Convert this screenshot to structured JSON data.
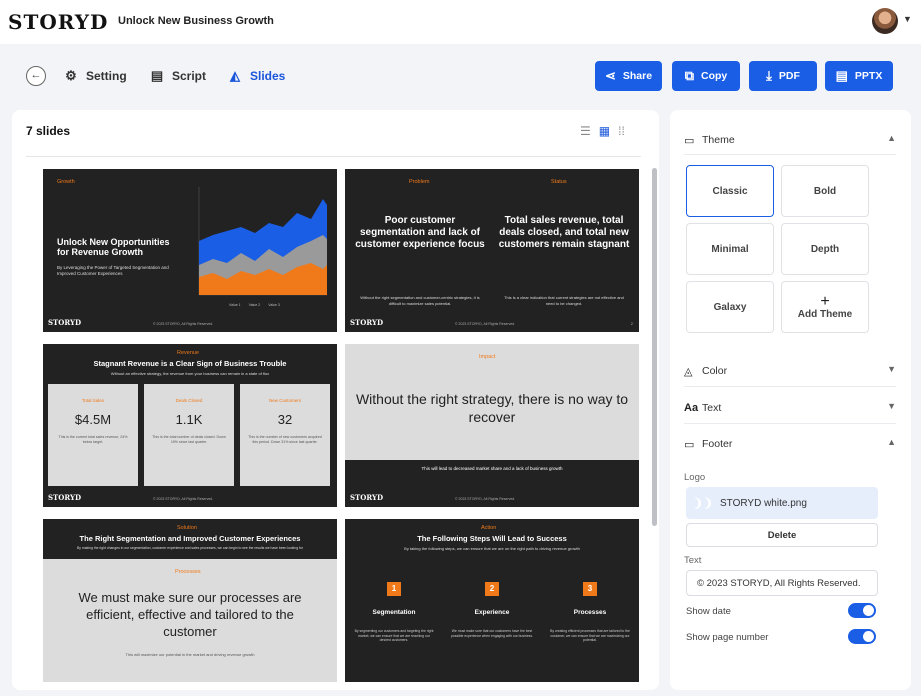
{
  "header": {
    "brand": "STORYD",
    "title": "Unlock New Business Growth"
  },
  "toolbar": {
    "setting_label": "Setting",
    "script_label": "Script",
    "slides_label": "Slides",
    "share_label": "Share",
    "copy_label": "Copy",
    "pdf_label": "PDF",
    "pptx_label": "PPTX"
  },
  "main": {
    "slide_count": "7 slides"
  },
  "slides": [
    {
      "label": "Growth",
      "title": "Unlock New Opportunities for Revenue Growth",
      "subtitle": "By Leveraging the Power of Targeted Segmentation and Improved Customer Experiences",
      "legend": [
        "Value 1",
        "Value 2",
        "Value 3"
      ]
    },
    {
      "left_label": "Problem",
      "left_title": "Poor customer segmentation and lack of customer experience focus",
      "left_text": "Without the right segmentation and customer-centric strategies, it is difficult to maximize sales potential.",
      "right_label": "Status",
      "right_title": "Total sales revenue, total deals closed, and total new customers remain stagnant",
      "right_text": "This is a clear indication that current strategies are not effective and need to be changed."
    },
    {
      "label": "Revenue",
      "title": "Stagnant Revenue is a Clear Sign of Business Trouble",
      "subtitle": "Without an effective strategy, the revenue from your business can remain in a state of flux",
      "cards": [
        {
          "label": "Total Sales",
          "value": "$4.5M",
          "text": "This is the current total sales revenue, 24% below target."
        },
        {
          "label": "Deals Closed",
          "value": "1.1K",
          "text": "This is the total number of deals closed. Down 19% since last quarter."
        },
        {
          "label": "New Customers",
          "value": "32",
          "text": "This is the number of new customers acquired this period. Down 31% since last quarter."
        }
      ]
    },
    {
      "label": "Impact",
      "title": "Without the right strategy, there is no way to recover",
      "footer_text": "This will lead to decreased market share and a lack of business growth"
    },
    {
      "label": "Solution",
      "title": "The Right Segmentation and Improved Customer Experiences",
      "subtitle": "By making the right changes in our segmentation, customer experience and sales processes, we can begin to see the results we have been looking for",
      "sub_label": "Processes",
      "body": "We must make sure our processes are efficient, effective and tailored to the customer",
      "footer_text": "This will maximize our potential in the market and driving revenue growth"
    },
    {
      "label": "Action",
      "title": "The Following Steps Will Lead to Success",
      "subtitle": "By taking the following steps, we can ensure that we are on the right path to driving revenue growth",
      "steps": [
        {
          "num": "1",
          "name": "Segmentation",
          "text": "By segmenting our customers and targeting the right market, we can ensure that we are reaching our desired customers."
        },
        {
          "num": "2",
          "name": "Experience",
          "text": "We must make sure that our customers have the best possible experience when engaging with our business."
        },
        {
          "num": "3",
          "name": "Processes",
          "text": "By creating efficient processes that are tailored to the customer, we can ensure that we are maximizing our potential."
        }
      ]
    }
  ],
  "slide_footer": {
    "logo": "STORYD",
    "copy": "© 2023 STORYD, All Rights Reserved."
  },
  "sidebar": {
    "theme_label": "Theme",
    "themes": [
      "Classic",
      "Bold",
      "Minimal",
      "Depth",
      "Galaxy"
    ],
    "add_theme_label": "Add Theme",
    "color_label": "Color",
    "text_label": "Text",
    "footer_label": "Footer",
    "logo_label": "Logo",
    "logo_file": "STORYD white.png",
    "delete_label": "Delete",
    "text_field_label": "Text",
    "footer_text_value": "© 2023 STORYD, All Rights Reserved.",
    "show_date_label": "Show date",
    "show_page_number_label": "Show page number",
    "show_date_on": true,
    "show_page_number_on": true
  },
  "colors": {
    "accent": "#1b5ee6",
    "slide_orange": "#f07a1a",
    "slide_dark": "#222222"
  }
}
